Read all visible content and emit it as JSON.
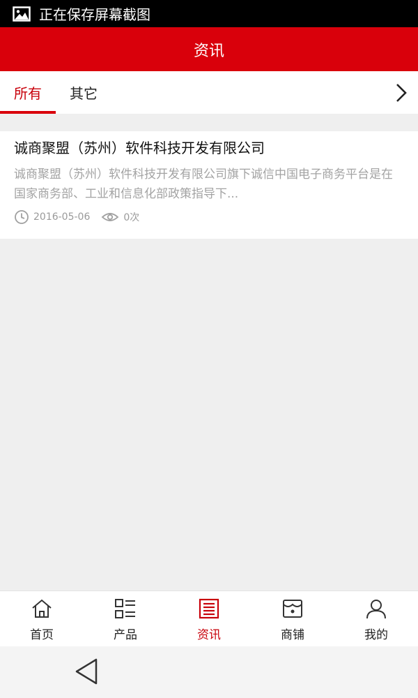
{
  "status_bar": {
    "icon": "image-icon",
    "text": "正在保存屏幕截图"
  },
  "header": {
    "title": "资讯"
  },
  "tabs": {
    "items": [
      {
        "label": "所有",
        "active": true
      },
      {
        "label": "其它",
        "active": false
      }
    ],
    "more_icon": "chevron-right-icon"
  },
  "articles": [
    {
      "title": "诚商聚盟（苏州）软件科技开发有限公司",
      "summary": "诚商聚盟（苏州）软件科技开发有限公司旗下诚信中国电子商务平台是在国家商务部、工业和信息化部政策指导下...",
      "date": "2016-05-06",
      "views": "0次"
    }
  ],
  "bottom_nav": {
    "items": [
      {
        "label": "首页",
        "icon": "home-icon",
        "active": false
      },
      {
        "label": "产品",
        "icon": "list-icon",
        "active": false
      },
      {
        "label": "资讯",
        "icon": "news-icon",
        "active": true
      },
      {
        "label": "商铺",
        "icon": "store-icon",
        "active": false
      },
      {
        "label": "我的",
        "icon": "user-icon",
        "active": false
      }
    ]
  },
  "colors": {
    "brand_red": "#d9000b",
    "active_red": "#c8000a",
    "text_dark": "#111111",
    "text_muted": "#a3a3a3",
    "background": "#efefef"
  }
}
